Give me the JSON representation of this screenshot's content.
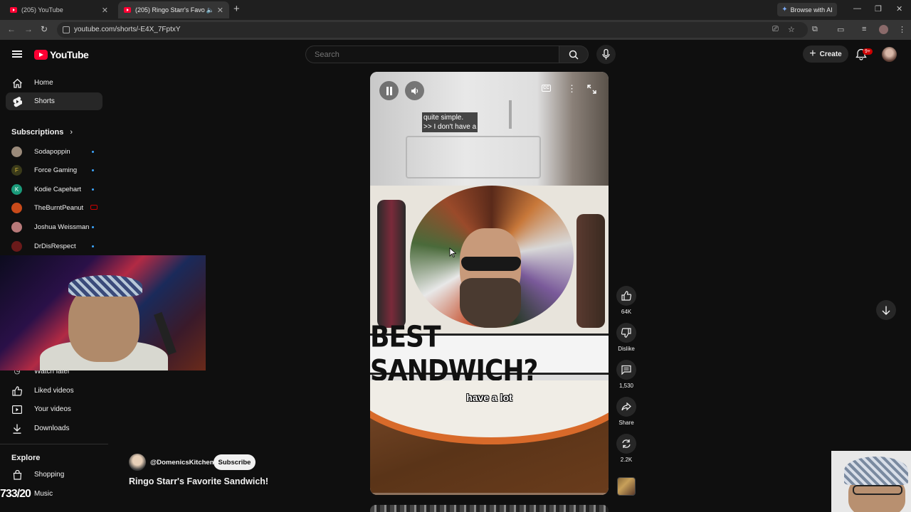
{
  "browser": {
    "tabs": [
      {
        "title": "(205) YouTube"
      },
      {
        "title": "(205) Ringo Starr's Favorite"
      }
    ],
    "url": "youtube.com/shorts/-E4X_7FptxY",
    "browse_ai_label": "Browse with AI"
  },
  "header": {
    "logo_text": "YouTube",
    "search_placeholder": "Search",
    "create_label": "Create",
    "notification_badge": "9+"
  },
  "sidebar": {
    "nav": [
      {
        "label": "Home",
        "icon": "home-icon"
      },
      {
        "label": "Shorts",
        "icon": "shorts-icon"
      }
    ],
    "subscriptions_heading": "Subscriptions",
    "subscriptions": [
      {
        "name": "Sodapoppin",
        "avatar_color": "#9a8a7a",
        "status": "new"
      },
      {
        "name": "Force Gaming",
        "avatar_color": "#3a3a1a",
        "status": "new"
      },
      {
        "name": "Kodie Capehart",
        "avatar_color": "#1a9a7a",
        "initial": "K",
        "status": "new"
      },
      {
        "name": "TheBurntPeanut",
        "avatar_color": "#c84a1a",
        "status": "live"
      },
      {
        "name": "Joshua Weissman",
        "avatar_color": "#b87a7a",
        "status": "new"
      },
      {
        "name": "DrDisRespect",
        "avatar_color": "#6a1a1a",
        "status": "new"
      }
    ],
    "you_items": [
      {
        "label": "Watch later",
        "icon": "clock-icon"
      },
      {
        "label": "Liked videos",
        "icon": "thumbs-up-icon"
      },
      {
        "label": "Your videos",
        "icon": "video-icon"
      },
      {
        "label": "Downloads",
        "icon": "download-icon"
      }
    ],
    "explore_heading": "Explore",
    "explore_items": [
      {
        "label": "Shopping",
        "icon": "shopping-bag-icon"
      },
      {
        "label": "Music",
        "icon": "music-icon"
      }
    ]
  },
  "overlay": {
    "counter": "733/20"
  },
  "short": {
    "channel": "@DomenicsKitchen",
    "subscribe_label": "Subscribe",
    "title": "Ringo Starr's Favorite Sandwich!",
    "caption_top": [
      "quite simple.",
      ">> I don't have a"
    ],
    "banner_text": "BEST SANDWICH?",
    "caption_bottom": "have a lot",
    "progress": 0.01
  },
  "actions": {
    "likes": "64K",
    "dislike_label": "Dislike",
    "comments": "1,530",
    "share_label": "Share",
    "remixes": "2.2K"
  },
  "colors": {
    "brand_red": "#ff0033",
    "background": "#0f0f0f",
    "surface": "#272727",
    "text": "#f1f1f1"
  }
}
